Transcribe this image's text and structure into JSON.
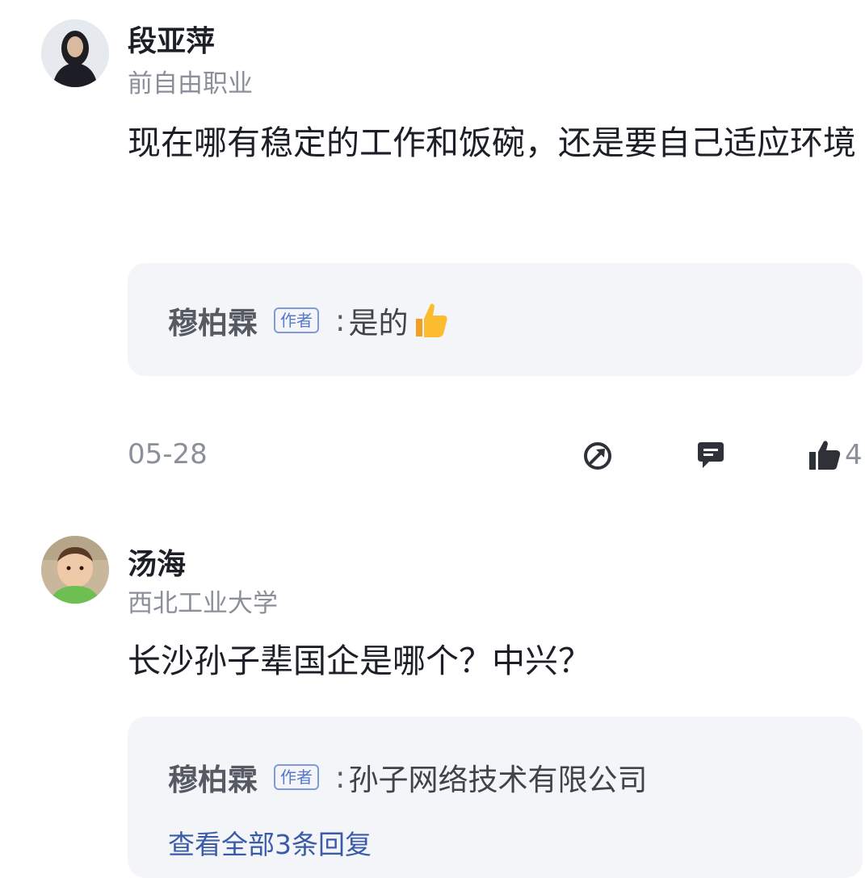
{
  "comments": [
    {
      "username": "段亚萍",
      "subtitle": "前自由职业",
      "content": "现在哪有稳定的工作和饭碗，还是要自己适应环境",
      "reply": {
        "author": "穆柏霖",
        "tag": "作者",
        "colon": ":",
        "text": "是的"
      },
      "date": "05-28",
      "like_count": "4"
    },
    {
      "username": "汤海",
      "subtitle": "西北工业大学",
      "content": "长沙孙子辈国企是哪个？中兴？",
      "reply": {
        "author": "穆柏霖",
        "tag": "作者",
        "colon": ":",
        "text": "孙子网络技术有限公司"
      },
      "view_all": "查看全部3条回复"
    }
  ],
  "icons": {
    "share": "share-icon",
    "comment": "comment-icon",
    "like": "thumbs-up-icon"
  },
  "colors": {
    "reply_bg": "#f4f5f8",
    "author_tag": "#5577cc",
    "link": "#3a5ba8"
  }
}
